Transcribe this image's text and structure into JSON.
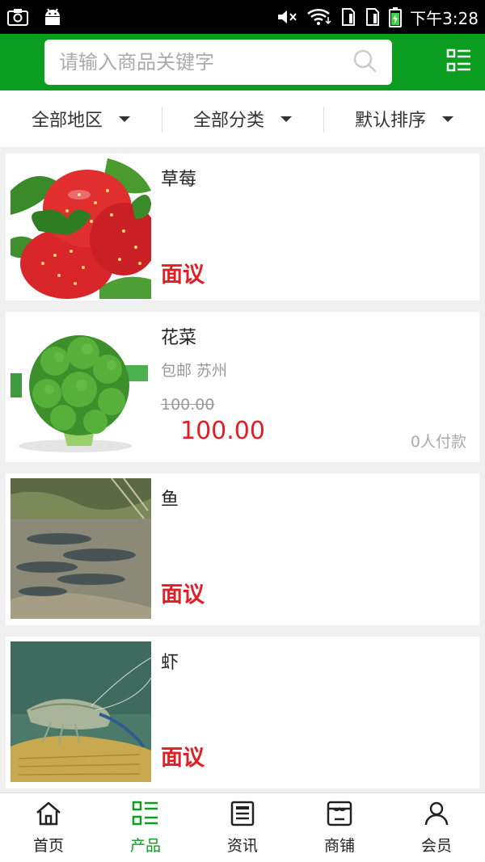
{
  "status_bar": {
    "time": "下午3:28",
    "icons": [
      "screenshot-icon",
      "android-icon",
      "mute-icon",
      "wifi-icon",
      "sim1-icon",
      "sim2-icon",
      "battery-icon"
    ]
  },
  "header": {
    "search_placeholder": "请输入商品关键字",
    "search_icon": "search-icon",
    "menu_icon": "category-menu-icon"
  },
  "filters": [
    {
      "label": "全部地区"
    },
    {
      "label": "全部分类"
    },
    {
      "label": "默认排序"
    }
  ],
  "products": [
    {
      "title": "草莓",
      "price_text": "面议",
      "image": "strawberry"
    },
    {
      "title": "花菜",
      "subtitle": "包邮 苏州",
      "old_price": "100.00",
      "price": "100.00",
      "paid": "0人付款",
      "image": "broccoli"
    },
    {
      "title": "鱼",
      "price_text": "面议",
      "image": "fish"
    },
    {
      "title": "虾",
      "price_text": "面议",
      "image": "shrimp"
    }
  ],
  "bottom_nav": [
    {
      "label": "首页",
      "icon": "home-icon"
    },
    {
      "label": "产品",
      "icon": "product-grid-icon",
      "active": true
    },
    {
      "label": "资讯",
      "icon": "news-icon"
    },
    {
      "label": "商铺",
      "icon": "shop-icon"
    },
    {
      "label": "会员",
      "icon": "member-icon"
    }
  ],
  "colors": {
    "accent": "#0a9d1f",
    "price": "#e51c23",
    "background": "#f0f0f0"
  }
}
